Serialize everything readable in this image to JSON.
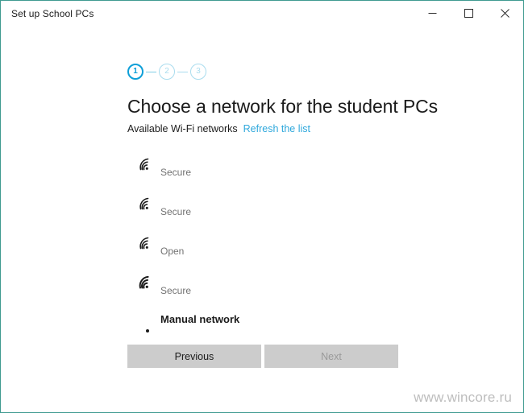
{
  "window": {
    "title": "Set up School PCs",
    "border_color": "#3f9a90",
    "controls": {
      "minimize": "minimize-button",
      "maximize": "maximize-button",
      "close": "close-button"
    }
  },
  "wizard": {
    "steps": [
      {
        "number": "1",
        "state": "active"
      },
      {
        "number": "2",
        "state": "inactive"
      },
      {
        "number": "3",
        "state": "inactive"
      }
    ],
    "active_color": "#0d9fd8",
    "inactive_color": "#a9dcee"
  },
  "page": {
    "title": "Choose a network for the student PCs",
    "subtitle": "Available Wi-Fi networks",
    "refresh_link": "Refresh the list",
    "link_color": "#2fa8dc"
  },
  "networks": [
    {
      "ssid": "",
      "status": "Secure",
      "signal": 3
    },
    {
      "ssid": "",
      "status": "Secure",
      "signal": 3
    },
    {
      "ssid": "",
      "status": "Open",
      "signal": 3
    },
    {
      "ssid": "",
      "status": "Secure",
      "signal": 4
    }
  ],
  "manual_network": {
    "label": "Manual network"
  },
  "footer": {
    "previous_label": "Previous",
    "next_label": "Next",
    "next_enabled": false,
    "button_color": "#cccccc"
  },
  "watermark": {
    "text": "www.wincore.ru"
  }
}
